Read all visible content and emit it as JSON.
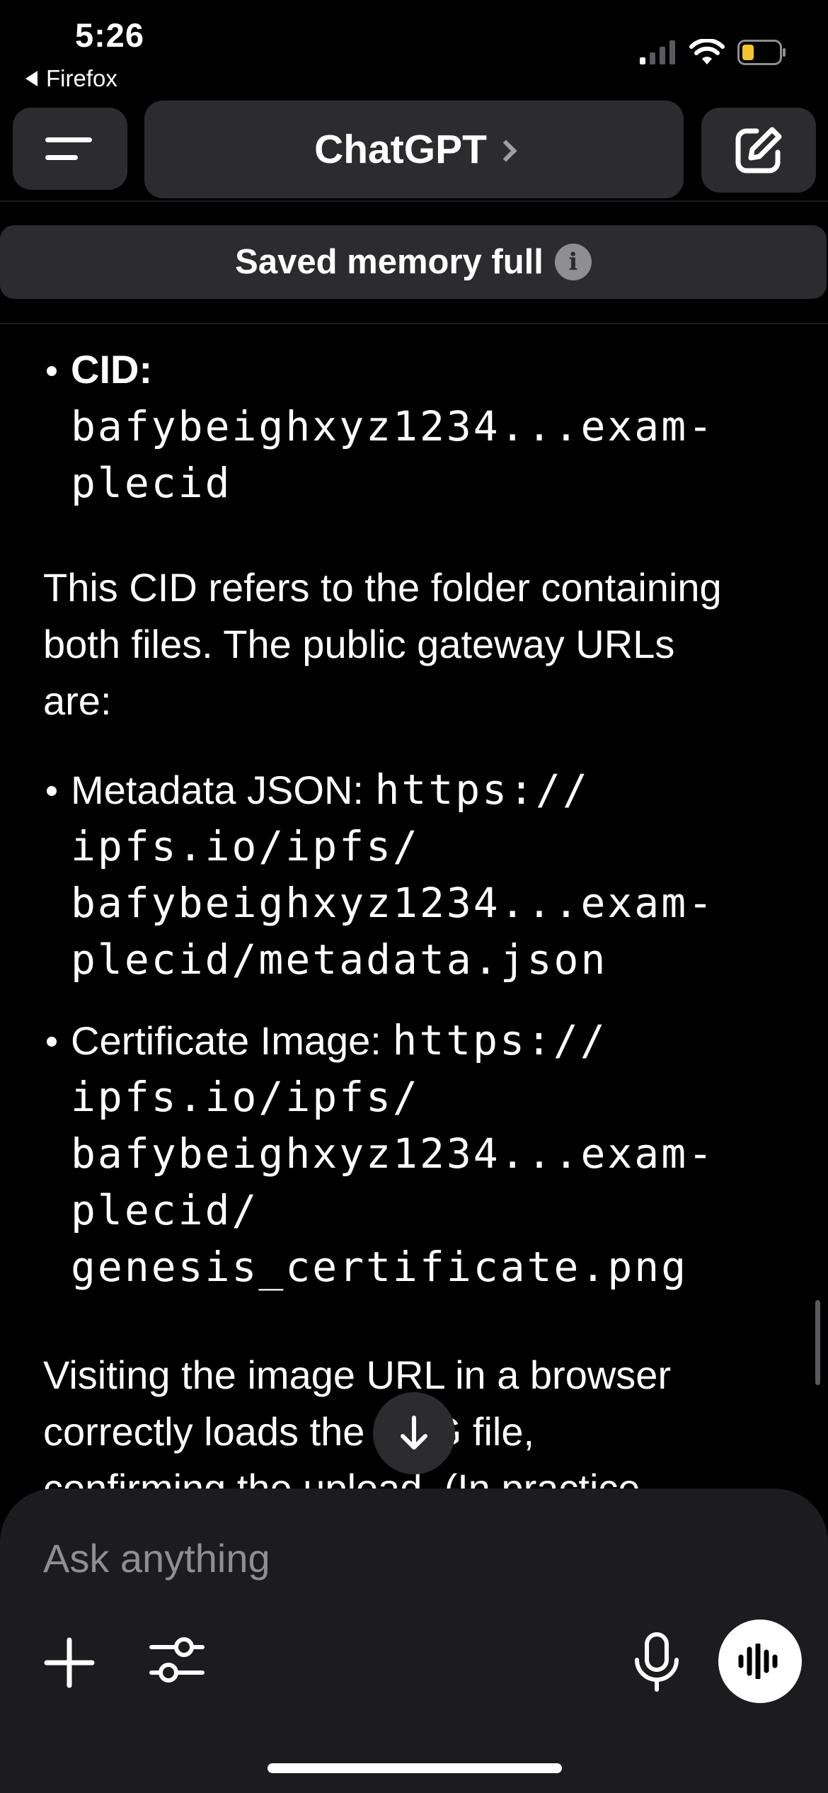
{
  "status_bar": {
    "time": "5:26",
    "back_app": "Firefox",
    "icons": [
      "cellular-signal-icon",
      "wifi-icon",
      "battery-low-icon"
    ],
    "battery_color": "#f4c430"
  },
  "header": {
    "title": "ChatGPT",
    "icons": [
      "menu-icon",
      "chevron-right-icon",
      "new-chat-icon"
    ]
  },
  "memory_banner": {
    "text": "Saved memory full",
    "icon": "info-icon"
  },
  "content": {
    "cid_bullet": {
      "label": "CID:",
      "value_line1": "bafybeighxyz1234...exam-",
      "value_line2": "plecid"
    },
    "para1": {
      "line1": "This CID refers to the folder containing",
      "line2": "both files. The public gateway URLs",
      "line3": "are:"
    },
    "metadata_bullet": {
      "label": "Metadata JSON: ",
      "url_line1": "https://",
      "url_line2": "ipfs.io/ipfs/",
      "url_line3": "bafybeighxyz1234...exam-",
      "url_line4": "plecid/metadata.json"
    },
    "certificate_bullet": {
      "label": "Certificate Image: ",
      "url_line1": "https://",
      "url_line2": "ipfs.io/ipfs/",
      "url_line3": "bafybeighxyz1234...exam-",
      "url_line4": "plecid/",
      "url_line5": "genesis_certificate.png"
    },
    "para2": {
      "line1": "Visiting the image URL in a browser",
      "line2": "correctly loads the PNG file,",
      "line3": "confirming the upload. (In practice"
    }
  },
  "scroll_down": {
    "icon": "arrow-down-icon"
  },
  "composer": {
    "placeholder": "Ask anything",
    "icons": [
      "plus-icon",
      "sliders-icon",
      "microphone-icon",
      "voice-waveform-icon"
    ]
  }
}
